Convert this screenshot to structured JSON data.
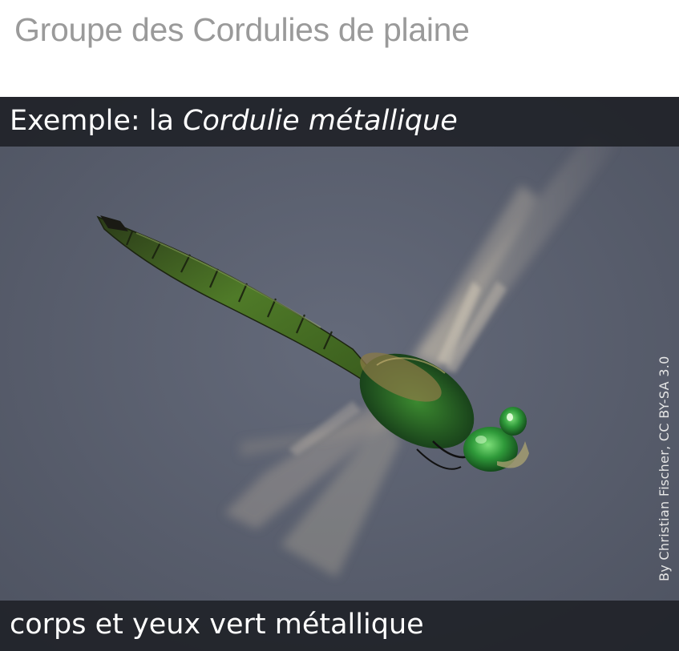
{
  "page": {
    "title": "Groupe des Cordulies de plaine"
  },
  "photo": {
    "subject": "dragonfly-in-flight",
    "caption_top_prefix": "Exemple: la ",
    "caption_top_species": "Cordulie métallique",
    "caption_bottom": "corps et yeux vert métallique",
    "credit": "By Christian Fischer, CC BY-SA 3.0"
  },
  "colors": {
    "title_text": "#9a9a9a",
    "band_background": "#1e2026",
    "background_water": "#5c6272",
    "body_green": "#3d6a24",
    "eye_green": "#2f9a3a"
  }
}
